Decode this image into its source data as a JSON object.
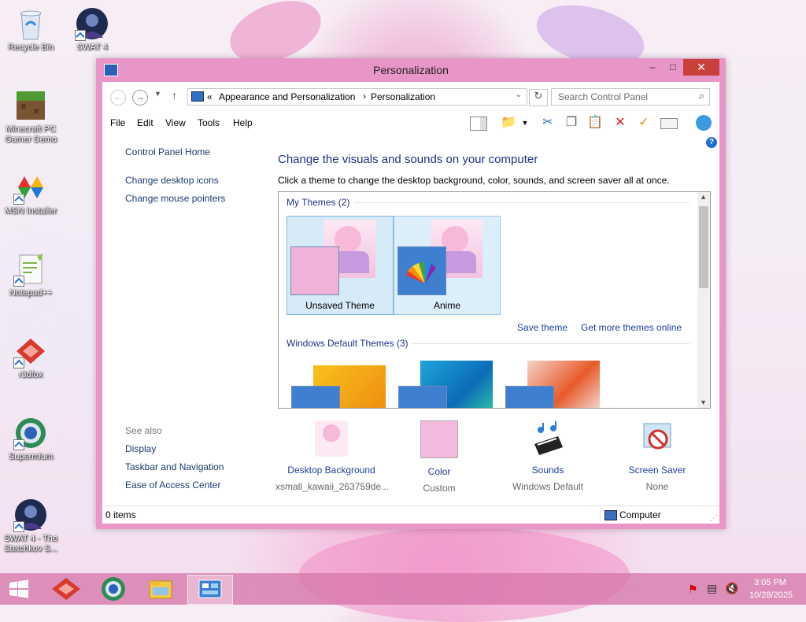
{
  "desktop": {
    "icons": [
      {
        "label": "Recycle Bin"
      },
      {
        "label": "SWAT 4"
      },
      {
        "label": "Minecraft PC Gamer Demo"
      },
      {
        "label": "MSN Installer"
      },
      {
        "label": "Notepad++"
      },
      {
        "label": "r3dfox"
      },
      {
        "label": "Supermium"
      },
      {
        "label": "SWAT 4 - The Stetchkov S..."
      }
    ]
  },
  "window": {
    "title": "Personalization",
    "buttons": {
      "minimize": "–",
      "maximize": "□",
      "close": "✕"
    },
    "address": {
      "prefix": "«",
      "crumb1": "Appearance and Personalization",
      "sep": "›",
      "crumb2": "Personalization"
    },
    "search_placeholder": "Search Control Panel",
    "menu": [
      "File",
      "Edit",
      "View",
      "Tools",
      "Help"
    ],
    "left_pane": {
      "home": "Control Panel Home",
      "links": [
        "Change desktop icons",
        "Change mouse pointers"
      ],
      "see_also_heading": "See also",
      "see_also": [
        "Display",
        "Taskbar and Navigation",
        "Ease of Access Center"
      ]
    },
    "heading": "Change the visuals and sounds on your computer",
    "subheading": "Click a theme to change the desktop background, color, sounds, and screen saver all at once.",
    "my_themes_heading": "My Themes (2)",
    "my_themes": [
      "Unsaved Theme",
      "Anime"
    ],
    "save_theme": "Save theme",
    "get_more": "Get more themes online",
    "default_themes_heading": "Windows Default Themes (3)",
    "bottom": [
      {
        "title": "Desktop Background",
        "value": "xsmall_kawaii_263759de..."
      },
      {
        "title": "Color",
        "value": "Custom"
      },
      {
        "title": "Sounds",
        "value": "Windows Default"
      },
      {
        "title": "Screen Saver",
        "value": "None"
      }
    ],
    "status": {
      "items": "0 items",
      "location": "Computer"
    }
  },
  "taskbar": {
    "time": "3:05 PM",
    "date": "10/28/2025"
  },
  "colors": {
    "window_frame": "#e995c8",
    "close": "#c7403a",
    "link": "#1e3ea0",
    "heading": "#1e3287"
  }
}
